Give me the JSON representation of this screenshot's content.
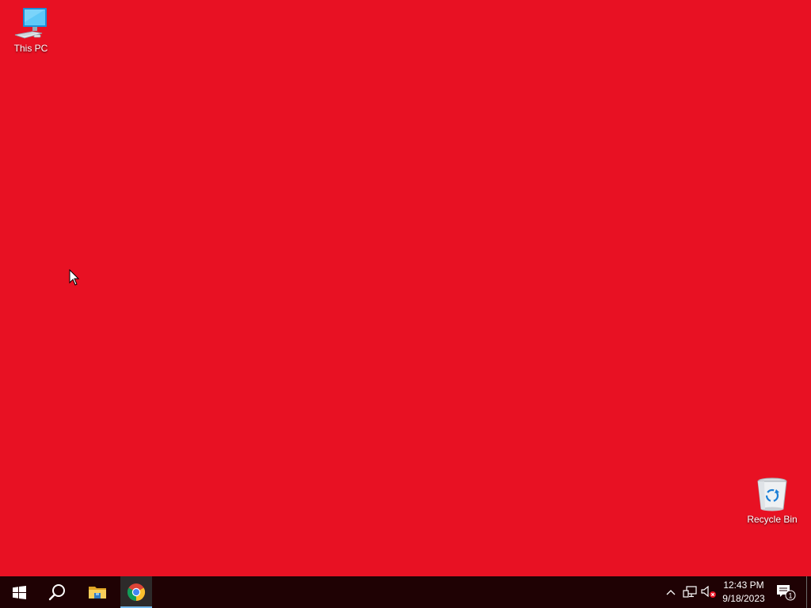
{
  "colors": {
    "desktop_background": "#e81123",
    "taskbar_background": "#1f0204",
    "chrome_active_tab": "#2d2a2a",
    "chrome_underline": "#76b9ed",
    "tray_text": "#ffffff"
  },
  "desktop": {
    "icons": [
      {
        "label": "This PC",
        "icon": "computer-icon"
      },
      {
        "label": "Recycle Bin",
        "icon": "recycle-bin-icon"
      }
    ]
  },
  "taskbar": {
    "pinned": [
      {
        "name": "Start",
        "icon": "windows-logo-icon"
      },
      {
        "name": "Search",
        "icon": "search-icon"
      },
      {
        "name": "File Explorer",
        "icon": "folder-icon"
      },
      {
        "name": "Google Chrome",
        "icon": "chrome-icon",
        "active": true
      }
    ],
    "tray": {
      "icons": [
        "chevron-up-icon",
        "network-icon",
        "volume-muted-icon"
      ],
      "time": "12:43 PM",
      "date": "9/18/2023",
      "notification_count": "1"
    }
  }
}
